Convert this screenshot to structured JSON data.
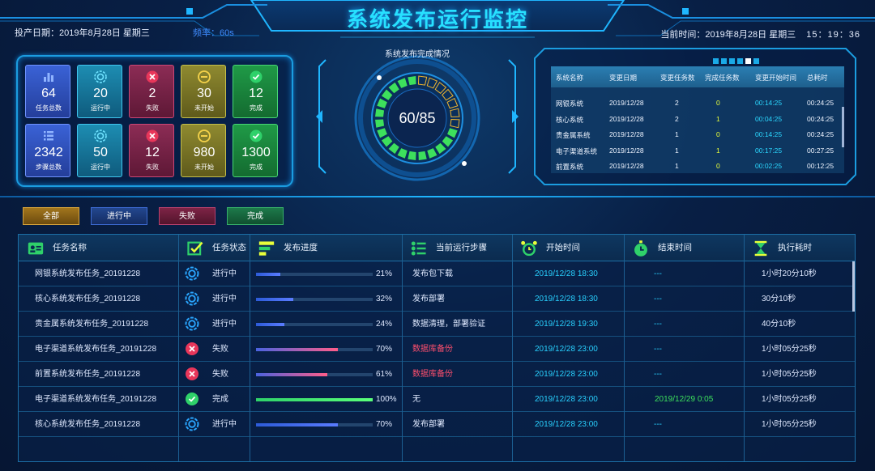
{
  "header": {
    "title": "系统发布运行监控",
    "left_info": "投产日期：2019年8月28日  星期三",
    "frequency": "频率：60s",
    "right_info": "当前时间：2019年8月28日 星期三",
    "clock": "15：19：36"
  },
  "stats": [
    {
      "num": "64",
      "label": "任务总数",
      "color": "blue",
      "icon": "bar-chart-icon"
    },
    {
      "num": "20",
      "label": "运行中",
      "color": "teal",
      "icon": "running-gear-icon"
    },
    {
      "num": "2",
      "label": "失败",
      "color": "red",
      "icon": "fail-x-icon"
    },
    {
      "num": "30",
      "label": "未开始",
      "color": "olive",
      "icon": "minus-circle-icon"
    },
    {
      "num": "12",
      "label": "完成",
      "color": "green",
      "icon": "check-circle-icon"
    },
    {
      "num": "2342",
      "label": "步骤总数",
      "color": "blue",
      "icon": "list-icon"
    },
    {
      "num": "50",
      "label": "运行中",
      "color": "teal",
      "icon": "running-gear-icon"
    },
    {
      "num": "12",
      "label": "失败",
      "color": "red",
      "icon": "fail-x-icon"
    },
    {
      "num": "980",
      "label": "未开始",
      "color": "olive",
      "icon": "minus-circle-icon"
    },
    {
      "num": "1300",
      "label": "完成",
      "color": "green",
      "icon": "check-circle-icon"
    }
  ],
  "gauge": {
    "title": "系统发布完成情况",
    "value_text": "60/85",
    "completed": 60,
    "total": 85
  },
  "mini_table": {
    "headers": [
      "系统名称",
      "变更日期",
      "变更任务数",
      "完成任务数",
      "变更开始时间",
      "总耗时"
    ],
    "rows": [
      [
        "网银系统",
        "2019/12/28",
        "2",
        "0",
        "00:14:25",
        "00:24:25"
      ],
      [
        "核心系统",
        "2019/12/28",
        "2",
        "1",
        "00:04:25",
        "00:24:25"
      ],
      [
        "贵金属系统",
        "2019/12/28",
        "1",
        "0",
        "00:14:25",
        "00:24:25"
      ],
      [
        "电子渠道系统",
        "2019/12/28",
        "1",
        "1",
        "00:17:25",
        "00:27:25"
      ],
      [
        "前置系统",
        "2019/12/28",
        "1",
        "0",
        "00:02:25",
        "00:12:25"
      ]
    ],
    "page_dots": 6,
    "active_dot": 5
  },
  "filters": [
    "全部",
    "进行中",
    "失败",
    "完成"
  ],
  "table": {
    "headers": [
      "任务名称",
      "任务状态",
      "发布进度",
      "当前运行步骤",
      "开始时间",
      "结束时间",
      "执行耗时"
    ],
    "header_icons": [
      "task-card-icon",
      "status-check-icon",
      "progress-icon",
      "steps-icon",
      "alarm-clock-icon",
      "stopwatch-icon",
      "hourglass-icon"
    ],
    "rows": [
      {
        "name": "网银系统发布任务_20191228",
        "status": "进行中",
        "status_type": "running",
        "progress": 21,
        "pct": "21%",
        "step": "发布包下载",
        "step_alert": false,
        "start": "2019/12/28 18:30",
        "end": "---",
        "duration": "1小时20分10秒"
      },
      {
        "name": "核心系统发布任务_20191228",
        "status": "进行中",
        "status_type": "running",
        "progress": 32,
        "pct": "32%",
        "step": "发布部署",
        "step_alert": false,
        "start": "2019/12/28 18:30",
        "end": "---",
        "duration": "30分10秒"
      },
      {
        "name": "贵金属系统发布任务_20191228",
        "status": "进行中",
        "status_type": "running",
        "progress": 24,
        "pct": "24%",
        "step": "数据清理，部署验证",
        "step_alert": false,
        "start": "2019/12/28 19:30",
        "end": "---",
        "duration": "40分10秒"
      },
      {
        "name": "电子渠道系统发布任务_20191228",
        "status": "失败",
        "status_type": "fail",
        "progress": 70,
        "pct": "70%",
        "step": "数据库备份",
        "step_alert": true,
        "start": "2019/12/28 23:00",
        "end": "---",
        "duration": "1小时05分25秒"
      },
      {
        "name": "前置系统发布任务_20191228",
        "status": "失败",
        "status_type": "fail",
        "progress": 61,
        "pct": "61%",
        "step": "数据库备份",
        "step_alert": true,
        "start": "2019/12/28 23:00",
        "end": "---",
        "duration": "1小时05分25秒"
      },
      {
        "name": "电子渠道系统发布任务_20191228",
        "status": "完成",
        "status_type": "done",
        "progress": 100,
        "pct": "100%",
        "step": "无",
        "step_alert": false,
        "start": "2019/12/28 23:00",
        "end": "2019/12/29 0:05",
        "duration": "1小时05分25秒"
      },
      {
        "name": "核心系统发布任务_20191228",
        "status": "进行中",
        "status_type": "running",
        "progress": 70,
        "pct": "70%",
        "step": "发布部署",
        "step_alert": false,
        "start": "2019/12/28 23:00",
        "end": "---",
        "duration": "1小时05分25秒"
      }
    ]
  },
  "colors": {
    "accent": "#27e0ff",
    "running_bar": "#4a68ff",
    "fail_bar": "#ff5d8a",
    "done_bar": "#3de05c",
    "alert_text": "#ff4f6e",
    "start_time_text": "#29d1ff",
    "end_done_text": "#3de05c"
  }
}
